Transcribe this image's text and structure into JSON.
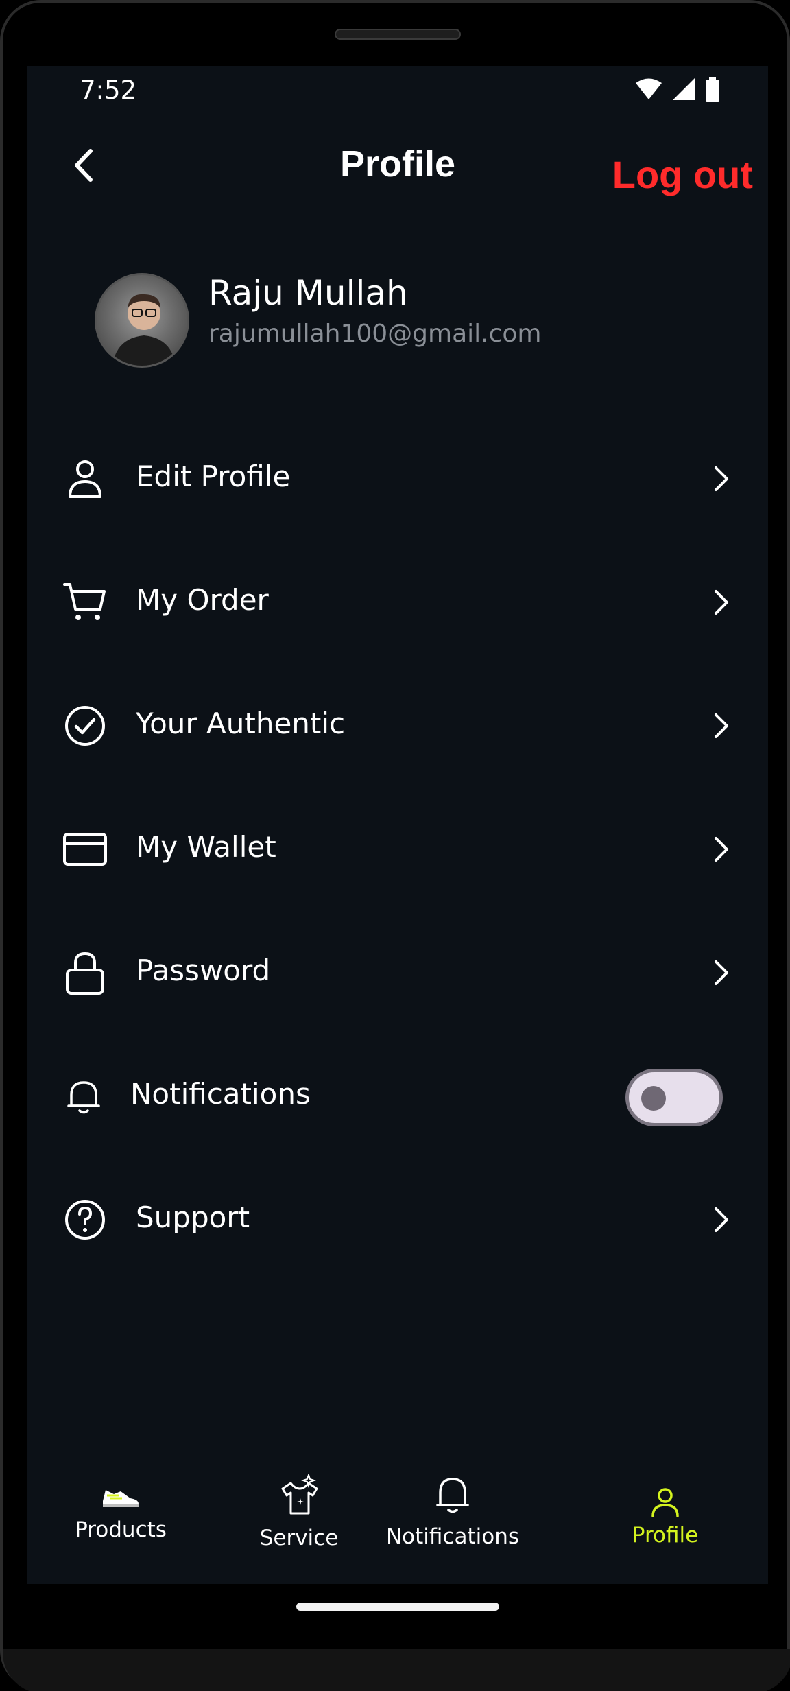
{
  "status_bar": {
    "time": "7:52"
  },
  "header": {
    "title": "Profile",
    "logout_label": "Log out"
  },
  "user": {
    "name": "Raju Mullah",
    "email": "rajumullah100@gmail.com"
  },
  "menu": [
    {
      "label": "Edit Profile",
      "icon": "user-icon"
    },
    {
      "label": "My Order",
      "icon": "cart-icon"
    },
    {
      "label": "Your Authentic",
      "icon": "check-circle-icon"
    },
    {
      "label": "My Wallet",
      "icon": "card-icon"
    },
    {
      "label": "Password",
      "icon": "lock-icon"
    },
    {
      "label": "Notifications",
      "icon": "bell-icon",
      "toggle_on": false
    },
    {
      "label": "Support",
      "icon": "help-circle-icon"
    }
  ],
  "bottom_nav": [
    {
      "label": "Products",
      "icon": "sneaker-icon",
      "active": false
    },
    {
      "label": "Service",
      "icon": "shirt-sparkle-icon",
      "active": false
    },
    {
      "label": "Notifications",
      "icon": "bell-icon",
      "active": false
    },
    {
      "label": "Profile",
      "icon": "user-icon",
      "active": true
    }
  ],
  "colors": {
    "background": "#0c1117",
    "logout": "#ff2b2b",
    "active_tab": "#d4f31f",
    "secondary_text": "#8a8f96"
  }
}
